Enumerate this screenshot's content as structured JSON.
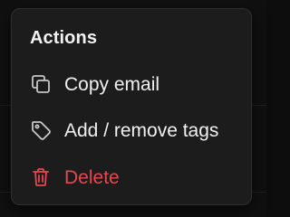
{
  "menu": {
    "title": "Actions",
    "items": [
      {
        "label": "Copy email",
        "icon": "copy-icon",
        "color": "#f0f0f0"
      },
      {
        "label": "Add / remove tags",
        "icon": "tag-icon",
        "color": "#f0f0f0"
      },
      {
        "label": "Delete",
        "icon": "trash-icon",
        "color": "#e5484d"
      }
    ]
  },
  "colors": {
    "menu_background": "#1c1c1c",
    "text": "#f0f0f0",
    "danger": "#e5484d",
    "icon_muted": "#c8c8c8"
  }
}
